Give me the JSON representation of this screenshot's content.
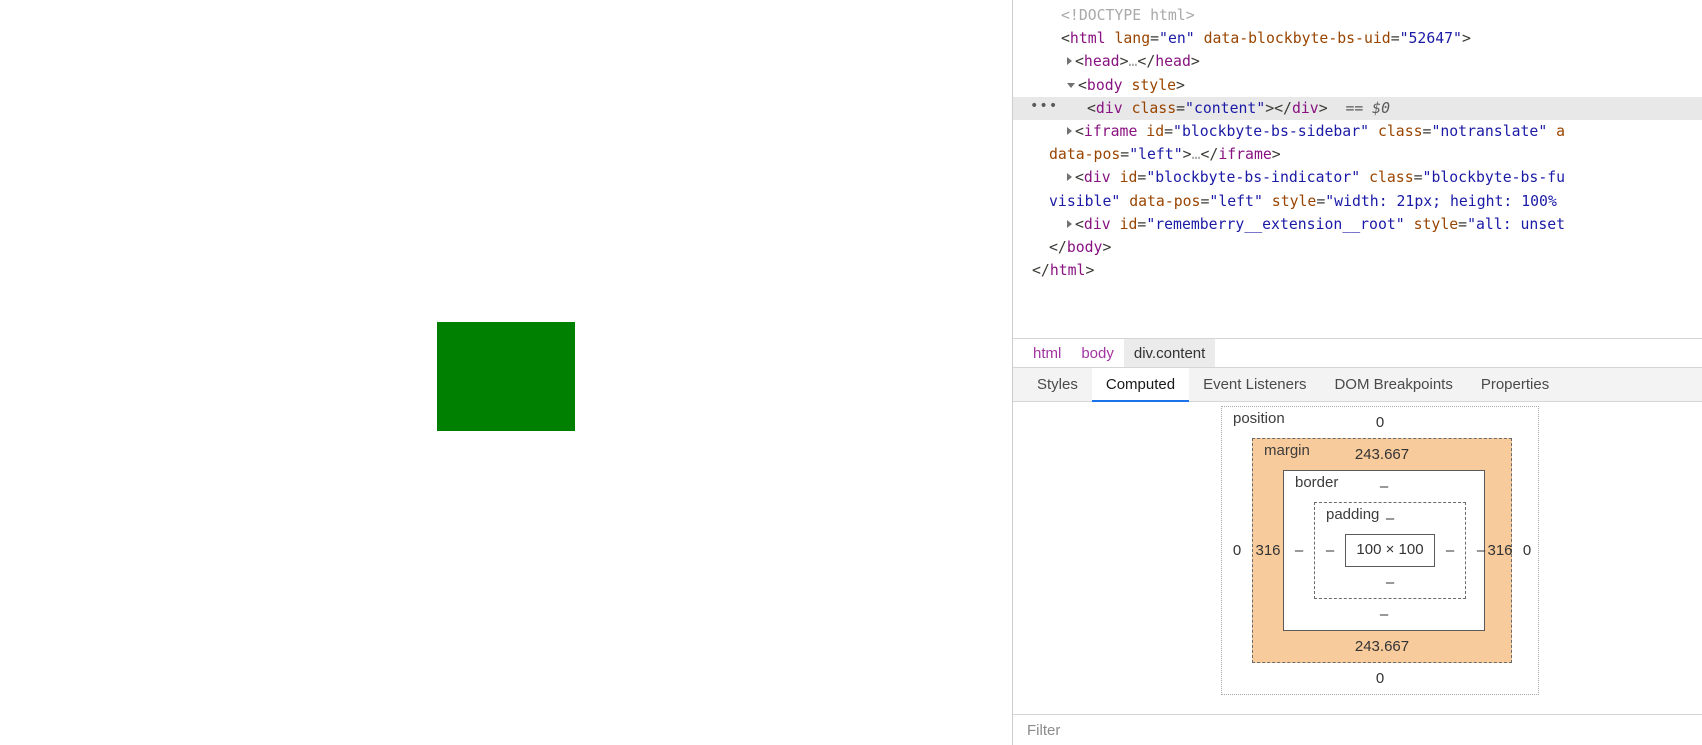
{
  "page": {
    "green_box": {
      "color": "#008000",
      "size_label": "100 x 100"
    }
  },
  "devtools": {
    "dom_tree": {
      "lines": [
        {
          "kind": "doctype",
          "text": "<!DOCTYPE html>"
        },
        {
          "kind": "open",
          "tag": "html",
          "attrs": [
            {
              "name": "lang",
              "value": "\"en\""
            },
            {
              "name": "data-blockbyte-bs-uid",
              "value": "\"52647\""
            }
          ]
        },
        {
          "kind": "collapsed",
          "text": "<head>…</head>"
        },
        {
          "kind": "open_body",
          "text": "<body style>"
        },
        {
          "kind": "selected",
          "text": "<div class=\"content\"></div>",
          "suffix": "== $0"
        },
        {
          "kind": "iframe",
          "text": "<iframe id=\"blockbyte-bs-sidebar\" class=\"notranslate\" a"
        },
        {
          "kind": "wrap",
          "text": "data-pos=\"left\">…</iframe>"
        },
        {
          "kind": "div_indicator",
          "text": "<div id=\"blockbyte-bs-indicator\" class=\"blockbyte-bs-fu"
        },
        {
          "kind": "wrap2",
          "text": "visible\" data-pos=\"left\" style=\"width: 21px; height: 100%"
        },
        {
          "kind": "div_remember",
          "text": "<div id=\"rememberry__extension__root\" style=\"all: unset"
        },
        {
          "kind": "close",
          "text": "</body>"
        },
        {
          "kind": "close_html",
          "text": "</html>"
        }
      ],
      "selected_marker": "•••"
    },
    "breadcrumb": {
      "items": [
        {
          "label": "html",
          "active": false
        },
        {
          "label": "body",
          "active": false
        },
        {
          "label": "div.content",
          "active": true
        }
      ]
    },
    "tabs": [
      {
        "label": "Styles",
        "active": false
      },
      {
        "label": "Computed",
        "active": true
      },
      {
        "label": "Event Listeners",
        "active": false
      },
      {
        "label": "DOM Breakpoints",
        "active": false
      },
      {
        "label": "Properties",
        "active": false
      }
    ],
    "accent_color": "#1a73e8",
    "box_model": {
      "position": {
        "label": "position",
        "top": "0",
        "left": "0",
        "right": "0",
        "bottom": "0"
      },
      "margin": {
        "label": "margin",
        "top": "243.667",
        "left": "316",
        "right": "316",
        "bottom": "243.667",
        "color": "#f8cb9c"
      },
      "border": {
        "label": "border",
        "top": "–",
        "left": "–",
        "right": "–",
        "bottom": "–"
      },
      "padding": {
        "label": "padding",
        "top": "–",
        "left": "–",
        "right": "–",
        "bottom": "–"
      },
      "content": {
        "size": "100 × 100"
      }
    },
    "filter": {
      "placeholder": "Filter"
    }
  }
}
